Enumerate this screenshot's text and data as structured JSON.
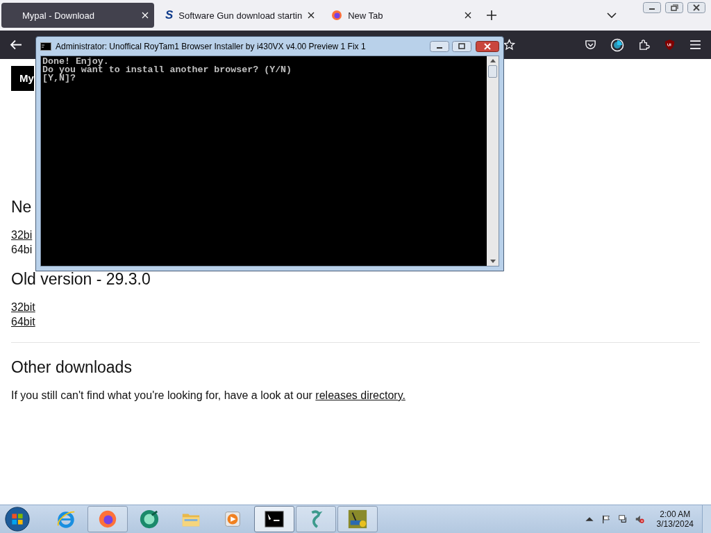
{
  "browser": {
    "tabs": [
      {
        "title": "Mypal - Download",
        "selected": true,
        "kind": "plain"
      },
      {
        "title": "Software Gun download startin",
        "selected": false,
        "kind": "text-logo",
        "logo": "S"
      },
      {
        "title": "New Tab",
        "selected": false,
        "kind": "globe"
      }
    ]
  },
  "page": {
    "banner": "My",
    "sections": [
      {
        "heading": "Ne",
        "links": [
          {
            "label": "32bi",
            "underlined": true
          },
          {
            "label": "64bi",
            "underlined": false
          }
        ]
      },
      {
        "heading": "Old version - 29.3.0",
        "links": [
          {
            "label": "32bit",
            "underlined": true
          },
          {
            "label": "64bit",
            "underlined": true
          }
        ]
      }
    ],
    "other": {
      "heading": "Other downloads",
      "text": "If you still can't find what you're looking for, have a look at our ",
      "link": "releases directory."
    }
  },
  "console": {
    "title": "Administrator:  Unoffical RoyTam1 Browser Installer by i430VX v4.00 Preview 1 Fix 1",
    "lines": [
      "Done! Enjoy.",
      "Do you want to install another browser? (Y/N)",
      "[Y,N]?"
    ]
  },
  "taskbar": {
    "apps": [
      {
        "kind": "ie",
        "running": false,
        "focused": false
      },
      {
        "kind": "firefox",
        "running": true,
        "focused": false
      },
      {
        "kind": "green-circle",
        "running": false,
        "focused": false
      },
      {
        "kind": "folder",
        "running": false,
        "focused": false
      },
      {
        "kind": "media",
        "running": false,
        "focused": false
      },
      {
        "kind": "console",
        "running": true,
        "focused": true
      },
      {
        "kind": "dragon",
        "running": true,
        "focused": false
      },
      {
        "kind": "installer",
        "running": true,
        "focused": false
      }
    ],
    "time": "2:00 AM",
    "date": "3/13/2024"
  }
}
